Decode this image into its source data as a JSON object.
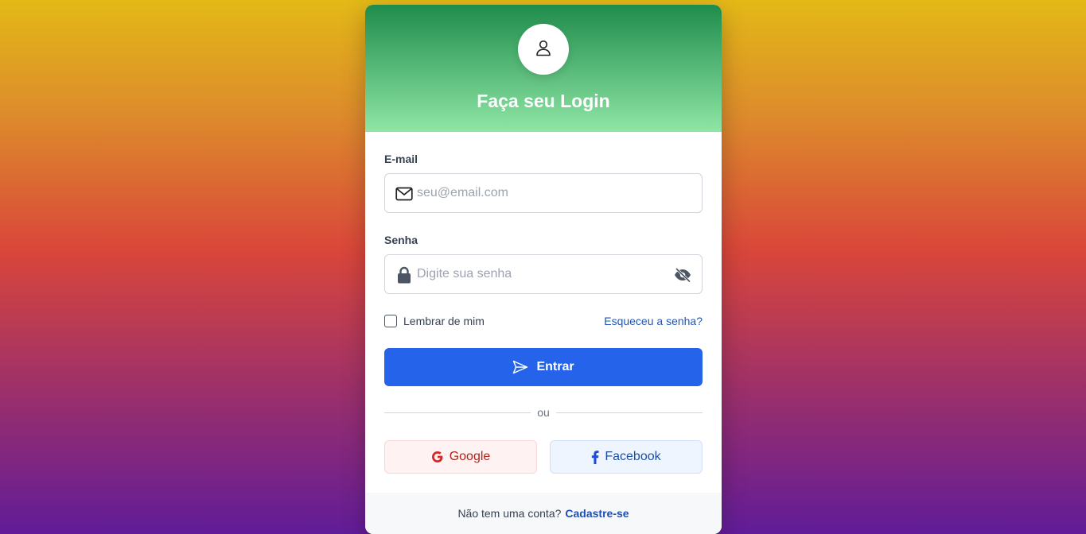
{
  "header": {
    "title": "Faça seu Login",
    "avatar_icon": "user-icon"
  },
  "email": {
    "label": "E-mail",
    "placeholder": "seu@email.com",
    "value": "",
    "icon": "envelope-icon"
  },
  "password": {
    "label": "Senha",
    "placeholder": "Digite sua senha",
    "value": "",
    "icon": "lock-icon",
    "toggle_icon": "eye-slash-icon"
  },
  "remember": {
    "label": "Lembrar de mim",
    "checked": false
  },
  "forgot": {
    "label": "Esqueceu a senha?"
  },
  "submit": {
    "label": "Entrar",
    "icon": "send-icon"
  },
  "divider": {
    "text": "ou"
  },
  "social": {
    "google": "Google",
    "facebook": "Facebook"
  },
  "footer": {
    "text": "Não tem uma conta?",
    "link": "Cadastre-se"
  },
  "colors": {
    "primary": "#2563eb",
    "header_top": "#1f8c4c",
    "header_bottom": "#8fe6a5",
    "google": "#dc2626",
    "facebook": "#1d4ed8"
  }
}
